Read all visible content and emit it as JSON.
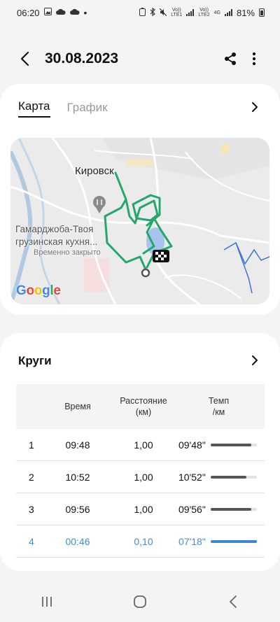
{
  "status_bar": {
    "time": "06:20",
    "network1_top": "Vo))",
    "network1_bottom": "LTE1",
    "network2_top": "Vo))",
    "network2_bottom": "LTE2",
    "network2_extra": "4G",
    "battery": "81%"
  },
  "header": {
    "title": "30.08.2023",
    "back_icon": "back-arrow-icon",
    "share_icon": "share-icon",
    "more_icon": "more-vertical-icon"
  },
  "map_card": {
    "tabs": [
      {
        "label": "Карта",
        "active": true
      },
      {
        "label": "График",
        "active": false
      }
    ],
    "map": {
      "city": "Кировск",
      "poi_name_line1": "Гамарджоба-Твоя",
      "poi_name_line2": "грузинская кухня...",
      "poi_status": "Временно закрыто",
      "attribution": "Google"
    },
    "route_color": "#22a86a"
  },
  "laps_card": {
    "title": "Круги",
    "columns": {
      "time": "Время",
      "distance_line1": "Расстояние",
      "distance_line2": "(км)",
      "pace_line1": "Темп",
      "pace_line2": "/км"
    },
    "rows": [
      {
        "num": "1",
        "time": "09:48",
        "distance": "1,00",
        "pace": "09'48\"",
        "pace_level": 0.88
      },
      {
        "num": "2",
        "time": "10:52",
        "distance": "1,00",
        "pace": "10'52\"",
        "pace_level": 0.78
      },
      {
        "num": "3",
        "time": "09:56",
        "distance": "1,00",
        "pace": "09'56\"",
        "pace_level": 0.88
      },
      {
        "num": "4",
        "time": "00:46",
        "distance": "0,10",
        "pace": "07'18\"",
        "pace_level": 1.0
      }
    ],
    "highlight_color": "#3f86d0"
  },
  "nav_bar": {
    "recent_icon": "recent-apps-icon",
    "home_icon": "home-icon",
    "back_icon": "back-icon"
  }
}
